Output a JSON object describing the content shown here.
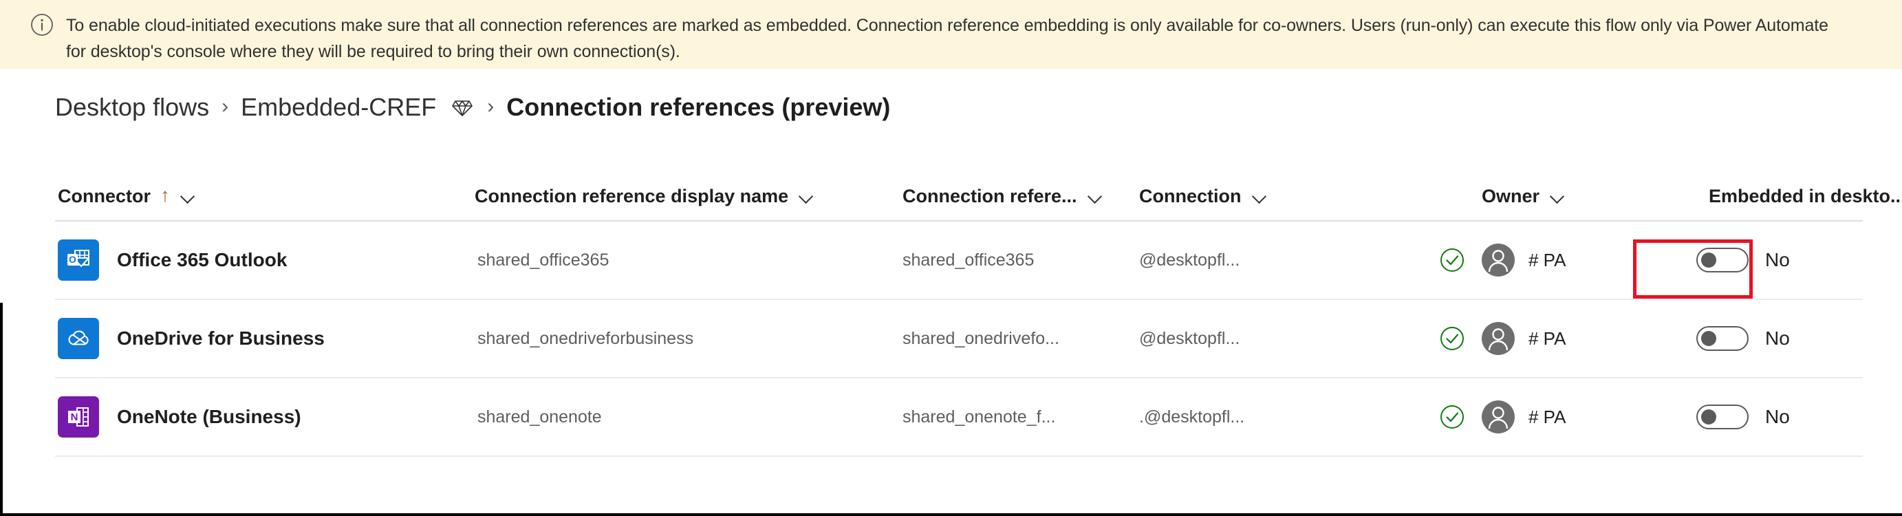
{
  "banner": {
    "icon": "info-circle-icon",
    "text": "To enable cloud-initiated executions make sure that all connection references are marked as embedded. Connection reference embedding is only available for co-owners. Users (run-only) can execute this flow only via Power Automate for desktop's console where they will be required to bring their own connection(s).",
    "background": "#fdf6dd"
  },
  "breadcrumb": {
    "items": [
      {
        "label": "Desktop flows",
        "current": false
      },
      {
        "label": "Embedded-CREF",
        "current": false
      },
      {
        "label": "Connection references (preview)",
        "current": true
      }
    ],
    "separator": "›",
    "solution_icon": "gem-icon"
  },
  "table": {
    "columns": [
      {
        "label": "Connector",
        "sorted": true,
        "sort_arrow": "↑",
        "has_chevron": true
      },
      {
        "label": "Connection reference display name",
        "sorted": false,
        "has_chevron": true
      },
      {
        "label": "Connection refere...",
        "sorted": false,
        "has_chevron": true
      },
      {
        "label": "Connection",
        "sorted": false,
        "has_chevron": true
      },
      {
        "label": "Owner",
        "sorted": false,
        "has_chevron": true
      },
      {
        "label": "Embedded in deskto...",
        "sorted": false,
        "has_chevron": false
      }
    ],
    "rows": [
      {
        "icon": "office-365-outlook-icon",
        "icon_color": "#0f78d4",
        "connector": "Office 365 Outlook",
        "display_name": "shared_office365",
        "reference_name": "shared_office365",
        "connection": "@desktopfl...",
        "status_icon": "check-circle-icon",
        "owner": "# PA",
        "embedded_state": false,
        "embedded_label": "No",
        "highlighted": true
      },
      {
        "icon": "onedrive-for-business-icon",
        "icon_color": "#0f78d4",
        "connector": "OneDrive for Business",
        "display_name": "shared_onedriveforbusiness",
        "reference_name": "shared_onedrivefo...",
        "connection": "@desktopfl...",
        "status_icon": "check-circle-icon",
        "owner": "# PA",
        "embedded_state": false,
        "embedded_label": "No",
        "highlighted": false
      },
      {
        "icon": "onenote-business-icon",
        "icon_color": "#7719aa",
        "connector": "OneNote (Business)",
        "display_name": "shared_onenote",
        "reference_name": "shared_onenote_f...",
        "connection": ".@desktopfl...",
        "status_icon": "check-circle-icon",
        "owner": "# PA",
        "embedded_state": false,
        "embedded_label": "No",
        "highlighted": false
      }
    ]
  },
  "annotation": {
    "color": "#e81123",
    "target": "embedded-toggle-row-1"
  }
}
